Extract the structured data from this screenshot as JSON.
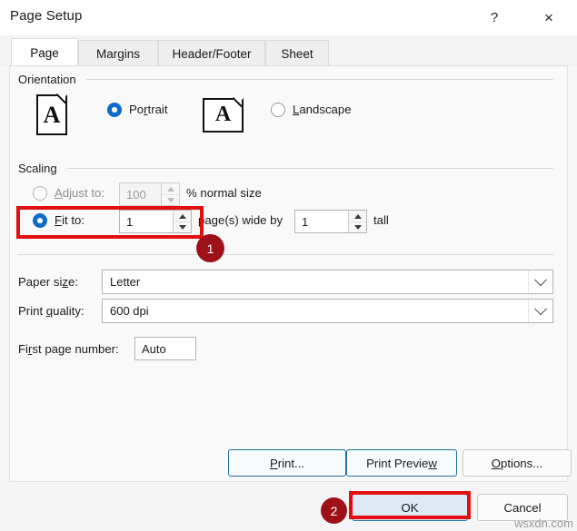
{
  "window": {
    "title": "Page Setup",
    "help_icon": "?",
    "close_icon": "×"
  },
  "tabs": [
    {
      "label": "Page",
      "active": true
    },
    {
      "label": "Margins",
      "active": false
    },
    {
      "label": "Header/Footer",
      "active": false
    },
    {
      "label": "Sheet",
      "active": false
    }
  ],
  "orientation": {
    "group_label": "Orientation",
    "portrait": {
      "label": "Portrait",
      "accel": "a",
      "selected": true,
      "icon_letter": "A"
    },
    "landscape": {
      "label": "Landscape",
      "accel": "L",
      "selected": false,
      "icon_letter": "A"
    }
  },
  "scaling": {
    "group_label": "Scaling",
    "adjust_to": {
      "label": "Adjust to:",
      "selected": false,
      "enabled": false,
      "value": "100",
      "suffix": "% normal size"
    },
    "fit_to": {
      "label": "Fit to:",
      "selected": true,
      "enabled": true,
      "pages_wide_value": "1",
      "middle_text": "page(s) wide by",
      "pages_tall_value": "1",
      "suffix": "tall"
    }
  },
  "paper": {
    "paper_size_label": "Paper size:",
    "paper_size_value": "Letter",
    "print_quality_label": "Print quality:",
    "print_quality_value": "600 dpi",
    "first_page_label": "First page number:",
    "first_page_value": "Auto"
  },
  "buttons": {
    "print": "Print...",
    "print_preview": "Print Preview",
    "options": "Options...",
    "ok": "OK",
    "cancel": "Cancel"
  },
  "annotations": {
    "badge_one": "1",
    "badge_two": "2",
    "highlight_color": "#e10f10",
    "badge_color": "#9e1119"
  },
  "watermark": "wsxdn.com"
}
